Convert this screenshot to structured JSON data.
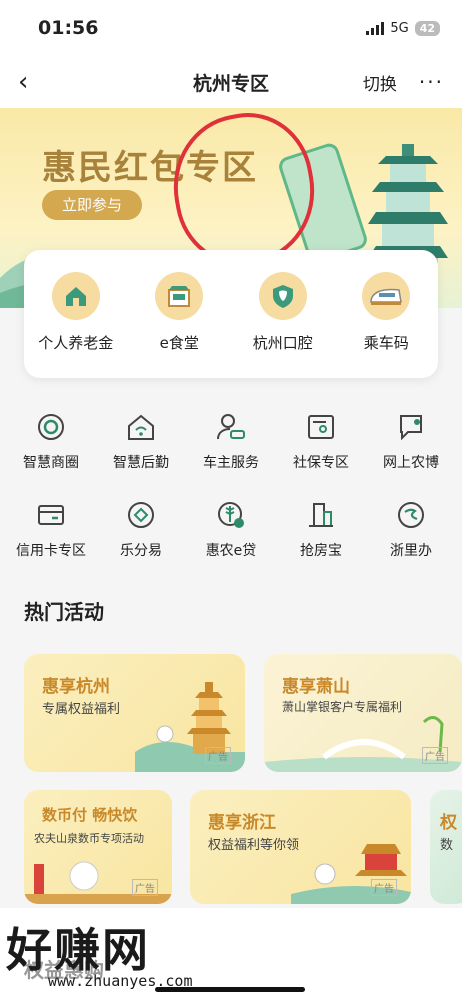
{
  "status": {
    "time": "01:56",
    "network": "5G",
    "battery": "42"
  },
  "nav": {
    "title": "杭州专区",
    "switch": "切换",
    "more": "···"
  },
  "banner": {
    "headline": "惠民红包专区",
    "join": "立即参与"
  },
  "quick": [
    {
      "label": "个人养老金",
      "icon": "house-yuan-icon"
    },
    {
      "label": "e食堂",
      "icon": "canteen-icon"
    },
    {
      "label": "杭州口腔",
      "icon": "tooth-icon"
    },
    {
      "label": "乘车码",
      "icon": "train-icon"
    }
  ],
  "grid": [
    [
      {
        "label": "智慧商圈",
        "icon": "target-icon"
      },
      {
        "label": "智慧后勤",
        "icon": "home-wifi-icon"
      },
      {
        "label": "车主服务",
        "icon": "person-car-icon"
      },
      {
        "label": "社保专区",
        "icon": "id-card-icon"
      },
      {
        "label": "网上农博",
        "icon": "leaf-chat-icon"
      }
    ],
    [
      {
        "label": "信用卡专区",
        "icon": "credit-card-icon"
      },
      {
        "label": "乐分易",
        "icon": "diamond-circle-icon"
      },
      {
        "label": "惠农e贷",
        "icon": "wheat-icon"
      },
      {
        "label": "抢房宝",
        "icon": "building-icon"
      },
      {
        "label": "浙里办",
        "icon": "zheli-icon"
      }
    ]
  ],
  "section_title": "热门活动",
  "cards": [
    {
      "title": "惠享杭州",
      "sub": "专属权益福利",
      "ad": "广告"
    },
    {
      "title": "惠享萧山",
      "sub": "萧山掌银客户专属福利",
      "ad": "广告"
    },
    {
      "title": "数币付 畅快饮",
      "sub": "农夫山泉数币专项活动",
      "ad": "广告"
    },
    {
      "title": "惠享浙江",
      "sub": "权益福利等你领",
      "ad": "广告"
    },
    {
      "title": "权",
      "sub": "数",
      "ad": ""
    }
  ],
  "watermark": {
    "big": "好赚网",
    "url": "www.zhuanyes.com",
    "under": "权益惠购"
  },
  "colors": {
    "accent": "#c9892a",
    "icon_green": "#2e8b67",
    "gold": "#d3a84f"
  }
}
